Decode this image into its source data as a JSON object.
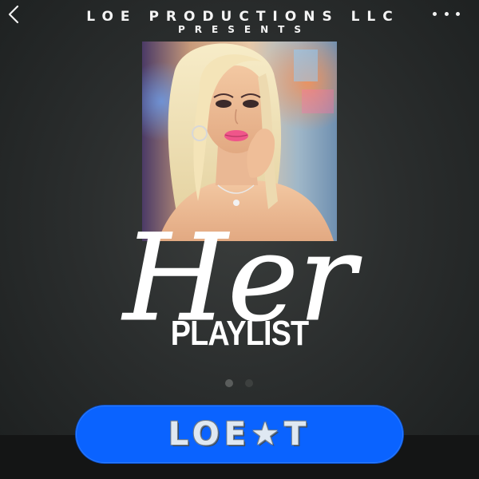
{
  "header": {
    "brand": "LOE PRODUCTIONS LLC",
    "presents": "PRESENTS"
  },
  "title": {
    "script": "Her",
    "subtitle": "PLAYLIST"
  },
  "carousel": {
    "dot_count": 2,
    "active_index": 0
  },
  "action_button": {
    "label": "LOE★T"
  },
  "icons": {
    "back": "back-chevron-icon",
    "more": "more-dots-icon"
  },
  "colors": {
    "button": "#0a63ff",
    "background": "#2b2e2e"
  }
}
